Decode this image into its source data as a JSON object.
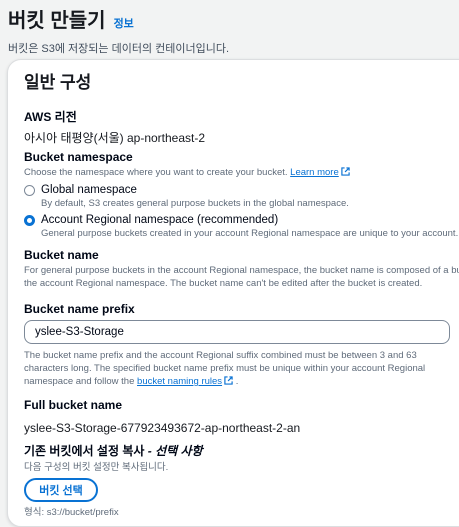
{
  "header": {
    "title": "버킷 만들기",
    "info_link": "정보",
    "description": "버킷은 S3에 저장되는 데이터의 컨테이너입니다."
  },
  "general": {
    "section_title": "일반 구성",
    "region_label": "AWS 리전",
    "region_value": "아시아 태평양(서울) ap-northeast-2",
    "namespace_label": "Bucket namespace",
    "namespace_desc": "Choose the namespace where you want to create your bucket.",
    "learn_more": "Learn more",
    "options": [
      {
        "label": "Global namespace",
        "desc": "By default, S3 creates general purpose buckets in the global namespace.",
        "selected": false
      },
      {
        "label": "Account Regional namespace (recommended)",
        "desc": "General purpose buckets created in your account Regional namespace are unique to your account. The",
        "selected": true
      }
    ],
    "bucket_name_label": "Bucket name",
    "bucket_name_desc_1": "For general purpose buckets in the account Regional namespace, the bucket name is composed of a bucke",
    "bucket_name_desc_2": "the account Regional namespace. The bucket name can't be edited after the bucket is created.",
    "prefix_label": "Bucket name prefix",
    "prefix_value": "yslee-S3-Storage",
    "prefix_desc_1": "The bucket name prefix and the account Regional suffix combined must be between 3 and 63",
    "prefix_desc_2": "characters long. The specified bucket name prefix must be unique within your account Regional",
    "prefix_desc_3": "namespace and follow the",
    "naming_rules_link": "bucket naming rules",
    "prefix_desc_end": ".",
    "full_name_label": "Full bucket name",
    "full_name_value": "yslee-S3-Storage-677923493672-ap-northeast-2-an",
    "copy_label": "기존 버킷에서 설정 복사",
    "copy_optional": "- 선택 사항",
    "copy_desc": "다음 구성의 버킷 설정만 복사됩니다.",
    "choose_bucket_button": "버킷 선택",
    "format_hint": "형식: s3://bucket/prefix"
  },
  "colors": {
    "link": "#0972d3",
    "text": "#16191f",
    "muted": "#5f6b7a",
    "background": "#f2f3f3"
  }
}
